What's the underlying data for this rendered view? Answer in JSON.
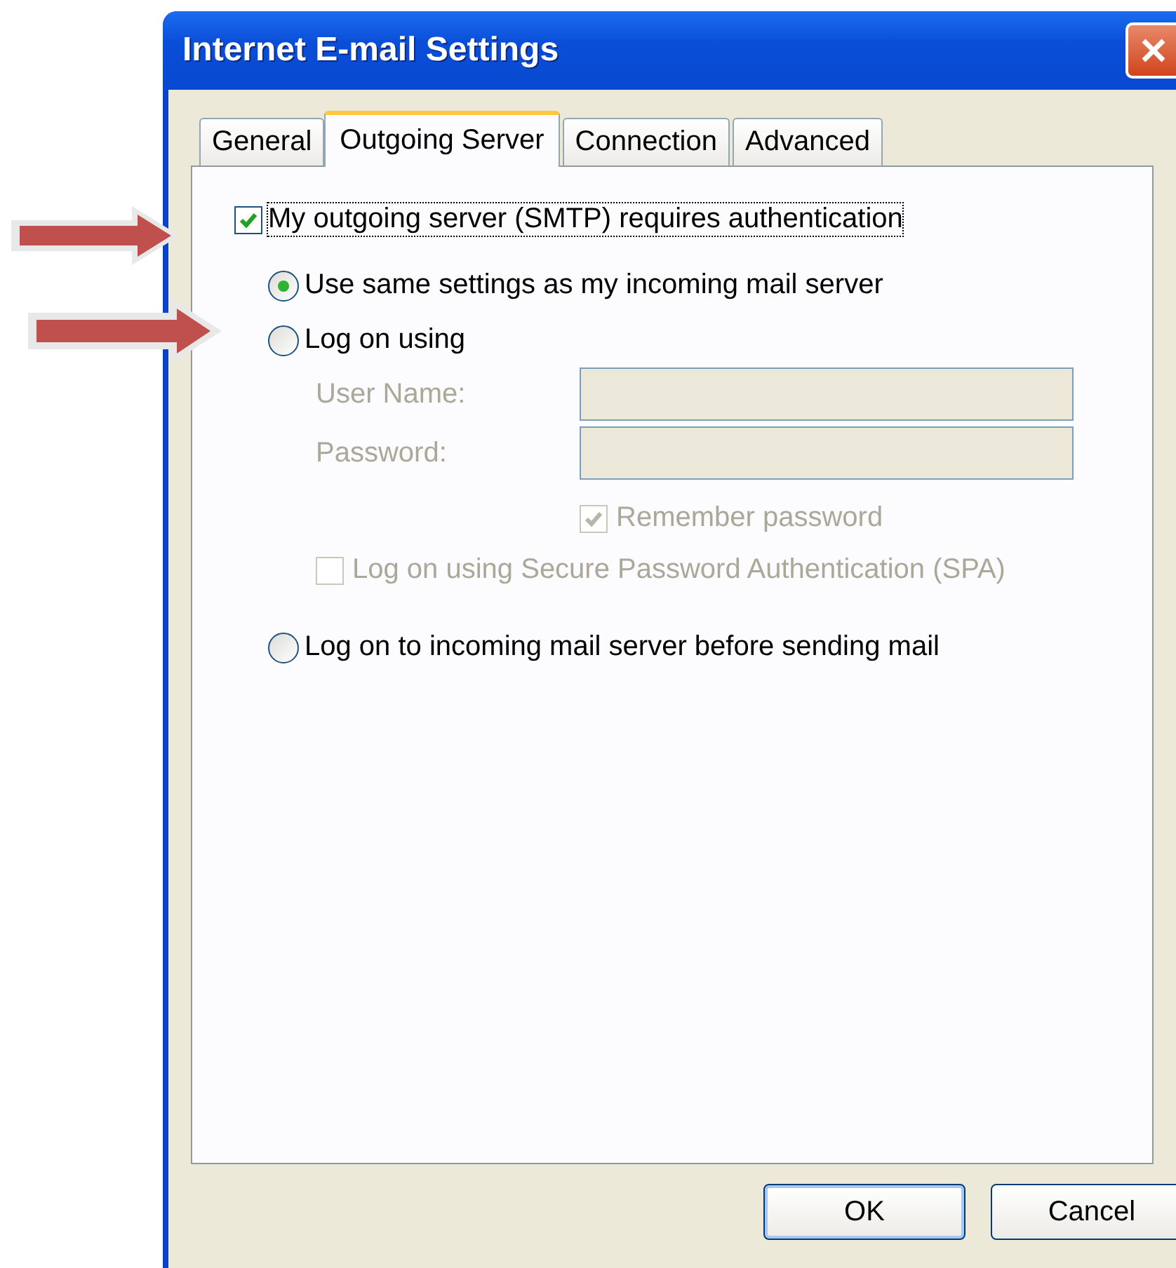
{
  "window": {
    "title": "Internet E-mail Settings"
  },
  "tabs": [
    {
      "label": "General",
      "selected": false
    },
    {
      "label": "Outgoing Server",
      "selected": true
    },
    {
      "label": "Connection",
      "selected": false
    },
    {
      "label": "Advanced",
      "selected": false
    }
  ],
  "auth_checkbox": {
    "label": "My outgoing server (SMTP) requires authentication",
    "checked": true,
    "focused": true
  },
  "radios": [
    {
      "label": "Use same settings as my incoming mail server",
      "selected": true
    },
    {
      "label": "Log on using",
      "selected": false
    },
    {
      "label": "Log on to incoming mail server before sending mail",
      "selected": false
    }
  ],
  "fields": [
    {
      "label": "User Name:",
      "disabled": true
    },
    {
      "label": "Password:",
      "disabled": true
    }
  ],
  "checkboxes": [
    {
      "label": "Remember password",
      "checked": true,
      "disabled": true
    },
    {
      "label": "Log on using Secure Password Authentication (SPA)",
      "checked": false,
      "disabled": true
    }
  ],
  "buttons": [
    {
      "label": "OK",
      "default": true
    },
    {
      "label": "Cancel",
      "default": false
    }
  ]
}
